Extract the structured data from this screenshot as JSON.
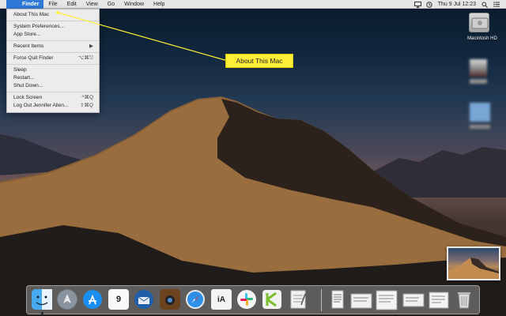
{
  "menubar": {
    "apple_glyph": "",
    "items": [
      "Finder",
      "File",
      "Edit",
      "View",
      "Go",
      "Window",
      "Help"
    ],
    "clock": "Thu 9 Jul  12:23"
  },
  "apple_menu": {
    "items": [
      {
        "label": "About This Mac",
        "shortcut": ""
      },
      {
        "label": "System Preferences...",
        "shortcut": ""
      },
      {
        "label": "App Store...",
        "shortcut": ""
      },
      {
        "label": "Recent Items",
        "shortcut": "▶"
      },
      {
        "label": "Force Quit Finder",
        "shortcut": "⌥⌘⎋"
      },
      {
        "label": "Sleep",
        "shortcut": ""
      },
      {
        "label": "Restart...",
        "shortcut": ""
      },
      {
        "label": "Shut Down...",
        "shortcut": ""
      },
      {
        "label": "Lock Screen",
        "shortcut": "^⌘Q"
      },
      {
        "label": "Log Out Jennifer Allen...",
        "shortcut": "⇧⌘Q"
      }
    ]
  },
  "callout": {
    "label": "About This Mac",
    "color": "#ffef36"
  },
  "desktop": {
    "hd_label": "Macintosh HD"
  },
  "dock": {
    "icons": [
      "finder-icon",
      "launchpad-icon",
      "app-store-icon",
      "calendar-icon",
      "thunderbird-icon",
      "photo-booth-icon",
      "safari-icon",
      "ia-writer-icon",
      "slack-icon",
      "keyboard-maestro-icon",
      "notes-icon",
      "document-icon",
      "trash-icon"
    ],
    "calendar_day": "9",
    "ia_text": "iA",
    "accent": "#2f79d8"
  }
}
